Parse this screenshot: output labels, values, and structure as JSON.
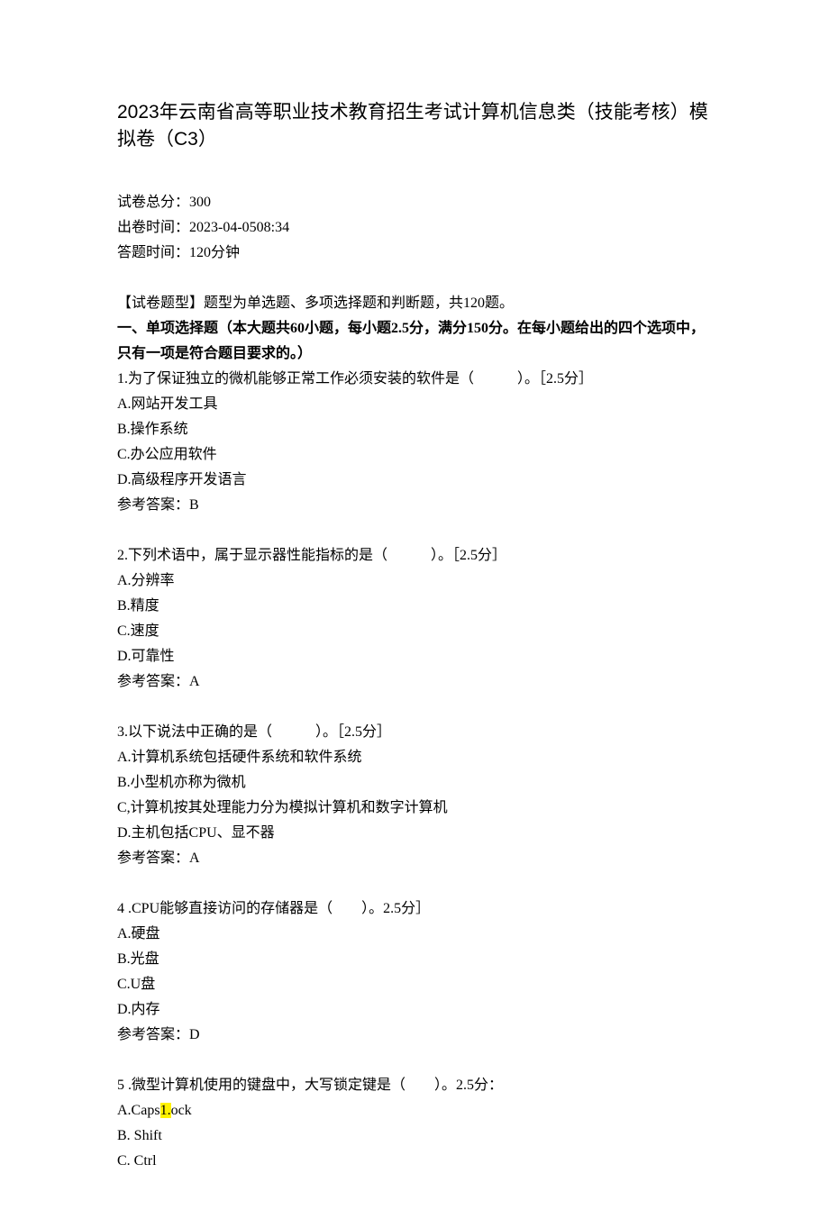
{
  "title": "2023年云南省高等职业技术教育招生考试计算机信息类（技能考核）模拟卷（C3）",
  "meta": {
    "total_score": "试卷总分：300",
    "issue_time": "出卷时间：2023-04-0508:34",
    "answer_time": "答题时间：120分钟"
  },
  "intro": "【试卷题型】题型为单选题、多项选择题和判断题，共120题。",
  "section1_heading": "一、单项选择题（本大题共60小题，每小题2.5分，满分150分。在每小题给出的四个选项中，只有一项是符合题目要求的。）",
  "questions": [
    {
      "stem": "1.为了保证独立的微机能够正常工作必须安装的软件是（　　　）。［2.5分］",
      "opts": [
        "A.网站开发工具",
        "B.操作系统",
        "C.办公应用软件",
        "D.高级程序开发语言"
      ],
      "answer": "参考答案：B"
    },
    {
      "stem": "2.下列术语中，属于显示器性能指标的是（　　　）。［2.5分］",
      "opts": [
        "A.分辨率",
        "B.精度",
        "C.速度",
        "D.可靠性"
      ],
      "answer": "参考答案：A"
    },
    {
      "stem": "3.以下说法中正确的是（　　　）。［2.5分］",
      "opts": [
        "A.计算机系统包括硬件系统和软件系统",
        "B.小型机亦称为微机",
        "C,计算机按其处理能力分为模拟计算机和数字计算机",
        "D.主机包括CPU、显不器"
      ],
      "answer": "参考答案：A"
    },
    {
      "stem": "4 .CPU能够直接访问的存储器是（　　）。2.5分］",
      "opts": [
        "A.硬盘",
        "B.光盘",
        "C.U盘",
        "D.内存"
      ],
      "answer": "参考答案：D"
    },
    {
      "stem": "5 .微型计算机使用的键盘中，大写锁定键是（　　）。2.5分：",
      "opt_a_pre": "A.Caps",
      "opt_a_hl": "1.",
      "opt_a_post": "ock",
      "opts_rest": [
        "B. Shift",
        "C. Ctrl"
      ]
    }
  ]
}
